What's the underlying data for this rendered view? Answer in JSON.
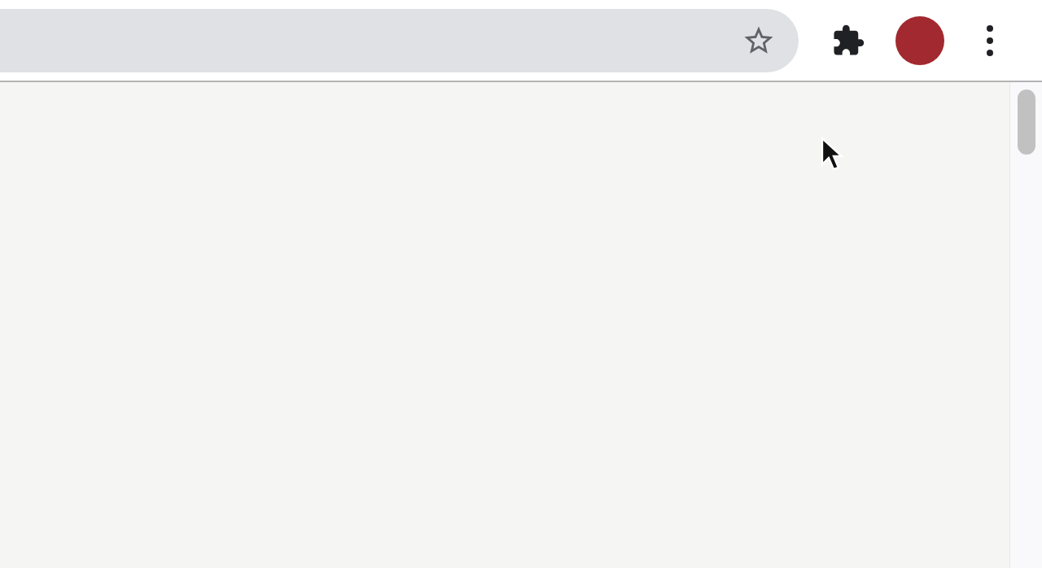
{
  "address_bar": {
    "bookmarked": false
  }
}
